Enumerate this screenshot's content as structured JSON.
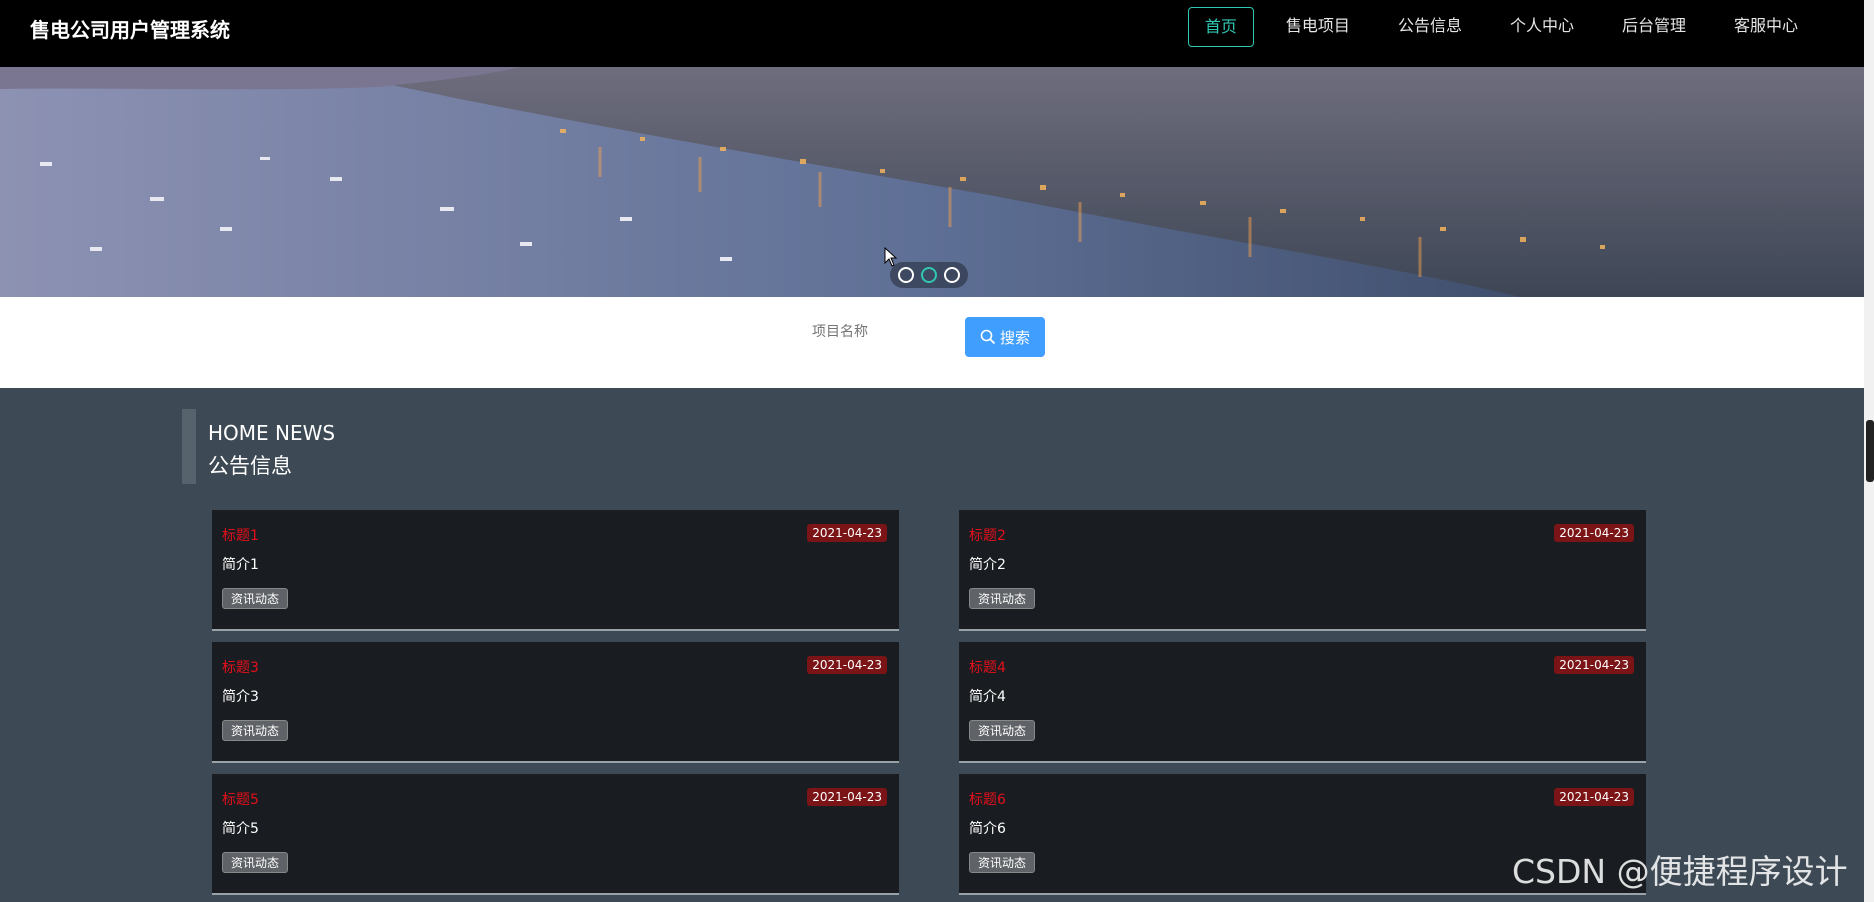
{
  "header": {
    "brand": "售电公司用户管理系统",
    "nav": [
      "首页",
      "售电项目",
      "公告信息",
      "个人中心",
      "后台管理",
      "客服中心"
    ]
  },
  "banner": {
    "slide_count": 3,
    "active_slide": 2
  },
  "search": {
    "placeholder": "项目名称",
    "button_label": "搜索"
  },
  "section": {
    "title_en": "HOME NEWS",
    "title_cn": "公告信息"
  },
  "news": [
    {
      "title": "标题1",
      "date": "2021-04-23",
      "intro": "简介1",
      "tag": "资讯动态"
    },
    {
      "title": "标题2",
      "date": "2021-04-23",
      "intro": "简介2",
      "tag": "资讯动态"
    },
    {
      "title": "标题3",
      "date": "2021-04-23",
      "intro": "简介3",
      "tag": "资讯动态"
    },
    {
      "title": "标题4",
      "date": "2021-04-23",
      "intro": "简介4",
      "tag": "资讯动态"
    },
    {
      "title": "标题5",
      "date": "2021-04-23",
      "intro": "简介5",
      "tag": "资讯动态"
    },
    {
      "title": "标题6",
      "date": "2021-04-23",
      "intro": "简介6",
      "tag": "资讯动态"
    }
  ],
  "watermark": "CSDN @便捷程序设计",
  "colors": {
    "accent": "#32c7b2",
    "search_button": "#409eff",
    "news_title": "#e4101c"
  }
}
